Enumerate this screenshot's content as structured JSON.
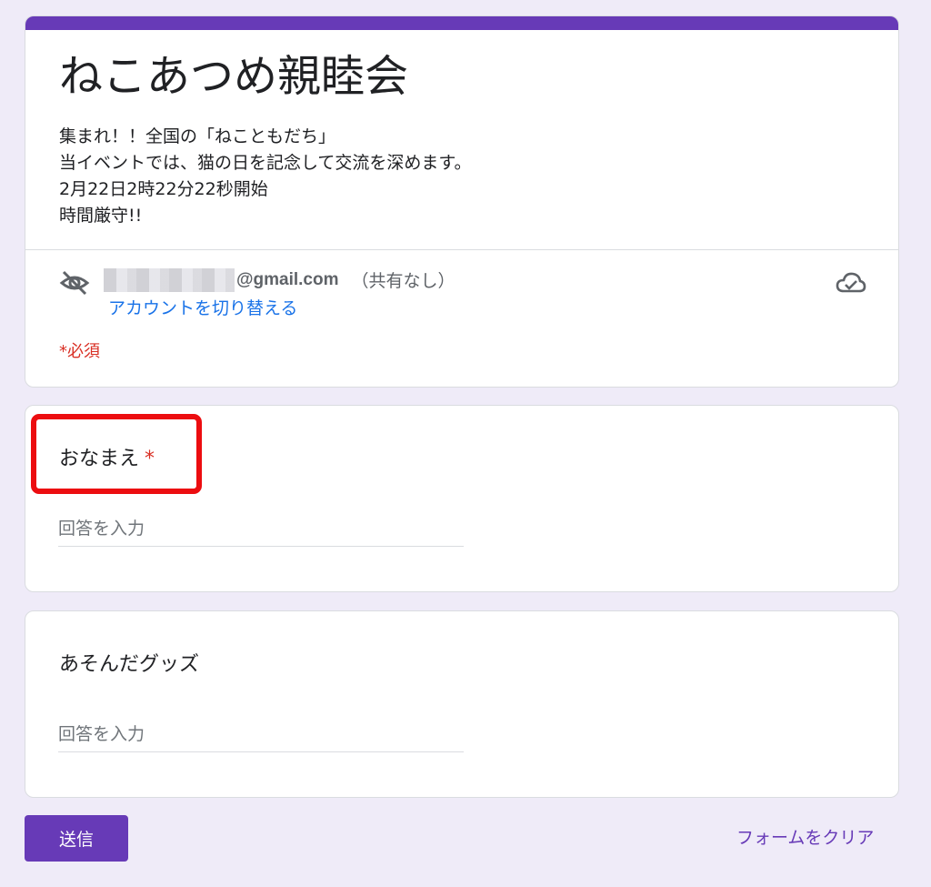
{
  "form": {
    "title": "ねこあつめ親睦会",
    "description": [
      "集まれ！！全国の「ねこともだち」",
      "当イベントでは、猫の日を記念して交流を深めます。",
      "2月22日2時22分22秒開始",
      "時間厳守!!"
    ],
    "accent_color": "#673ab7"
  },
  "account": {
    "email_domain": "@gmail.com",
    "share_status": "（共有なし）",
    "switch_link": "アカウントを切り替える",
    "icons": [
      "eye-off-icon",
      "cloud-check-icon"
    ]
  },
  "required_note": "*必須",
  "questions": [
    {
      "label": "おなまえ",
      "required": true,
      "required_mark": "*",
      "placeholder": "回答を入力",
      "value": ""
    },
    {
      "label": "あそんだグッズ",
      "required": false,
      "placeholder": "回答を入力",
      "value": ""
    }
  ],
  "actions": {
    "submit_label": "送信",
    "clear_label": "フォームをクリア"
  },
  "annotation": {
    "highlight_color": "#ec0d10"
  }
}
